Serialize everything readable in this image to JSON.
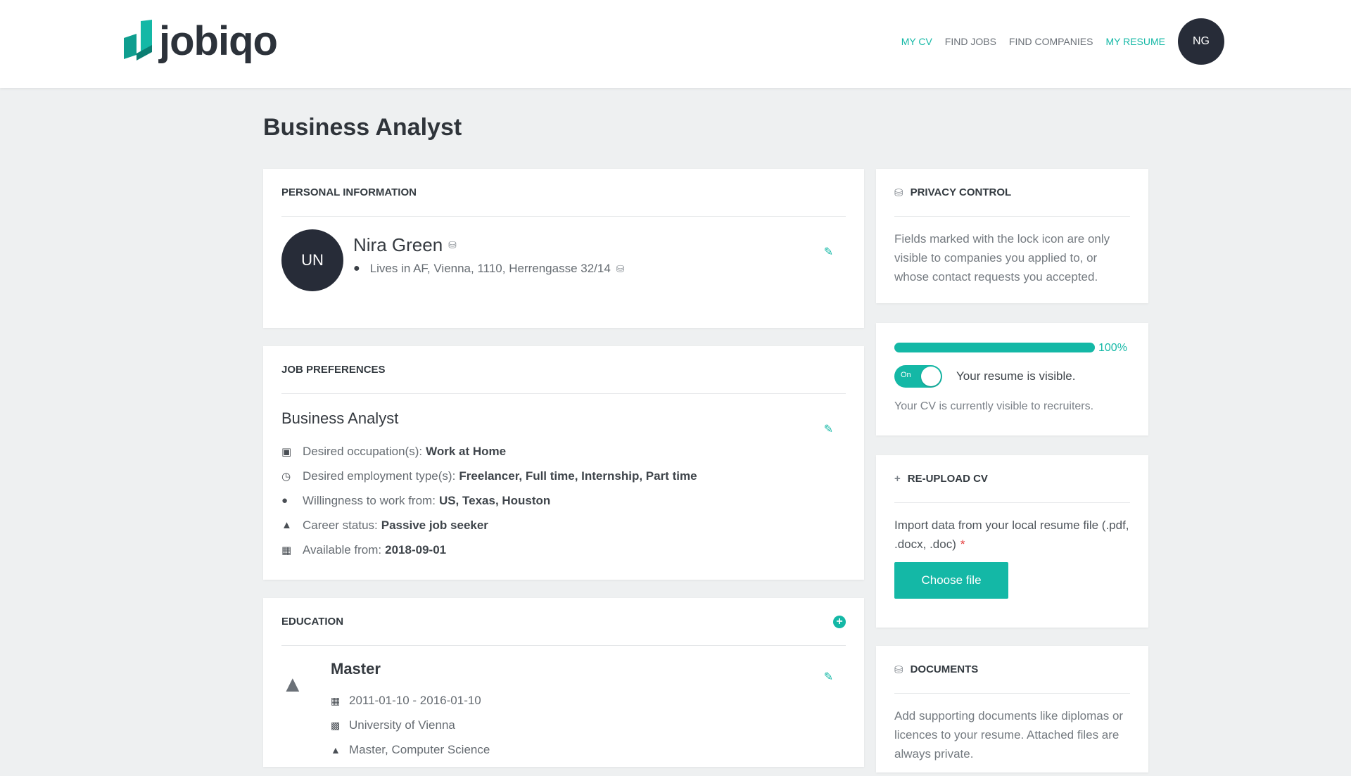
{
  "header": {
    "logo_text": "jobiqo",
    "nav": [
      {
        "label": "MY CV",
        "active": true
      },
      {
        "label": "FIND JOBS",
        "active": false
      },
      {
        "label": "FIND COMPANIES",
        "active": false
      },
      {
        "label": "MY RESUME",
        "active": true
      }
    ],
    "avatar_initials": "NG"
  },
  "page": {
    "title": "Business Analyst"
  },
  "personal": {
    "title": "PERSONAL INFORMATION",
    "avatar_initials": "UN",
    "name": "Nira Green",
    "address": "Lives in AF, Vienna, 1110, Herrengasse 32/14"
  },
  "job_preferences": {
    "title": "JOB PREFERENCES",
    "job_title": "Business Analyst",
    "rows": [
      {
        "icon": "briefcase-icon",
        "label": "Desired occupation(s):",
        "value": "Work at Home"
      },
      {
        "icon": "clock-icon",
        "label": "Desired employment type(s):",
        "value": "Freelancer, Full time, Internship, Part time"
      },
      {
        "icon": "location-pin-icon",
        "label": "Willingness to work from:",
        "value": "US, Texas, Houston"
      },
      {
        "icon": "graduation-cap-icon",
        "label": "Career status:",
        "value": "Passive job seeker"
      },
      {
        "icon": "calendar-icon",
        "label": "Available from:",
        "value": "2018-09-01"
      }
    ]
  },
  "education": {
    "title": "EDUCATION",
    "degree": "Master",
    "dates": "2011-01-10 - 2016-01-10",
    "institution": "University of Vienna",
    "field": "Master, Computer Science"
  },
  "privacy": {
    "title": "PRIVACY CONTROL",
    "text": "Fields marked with the lock icon are only visible to companies you applied to, or whose contact requests you accepted."
  },
  "visibility": {
    "progress_value": 1.0,
    "progress_label": "100%",
    "toggle_label": "On",
    "toggle_text": "Your resume is visible.",
    "status_text": "Your CV is currently visible to recruiters."
  },
  "reupload": {
    "title": "RE-UPLOAD CV",
    "text": "Import data from your local resume file (.pdf, .docx, .doc)",
    "required_mark": "*",
    "button_label": "Choose file"
  },
  "documents": {
    "title": "DOCUMENTS",
    "text": "Add supporting documents like diplomas or licences to your resume. Attached files are always private."
  },
  "colors": {
    "accent": "#14b8a6",
    "avatar_bg": "#272c38",
    "page_bg": "#eef0f1"
  }
}
